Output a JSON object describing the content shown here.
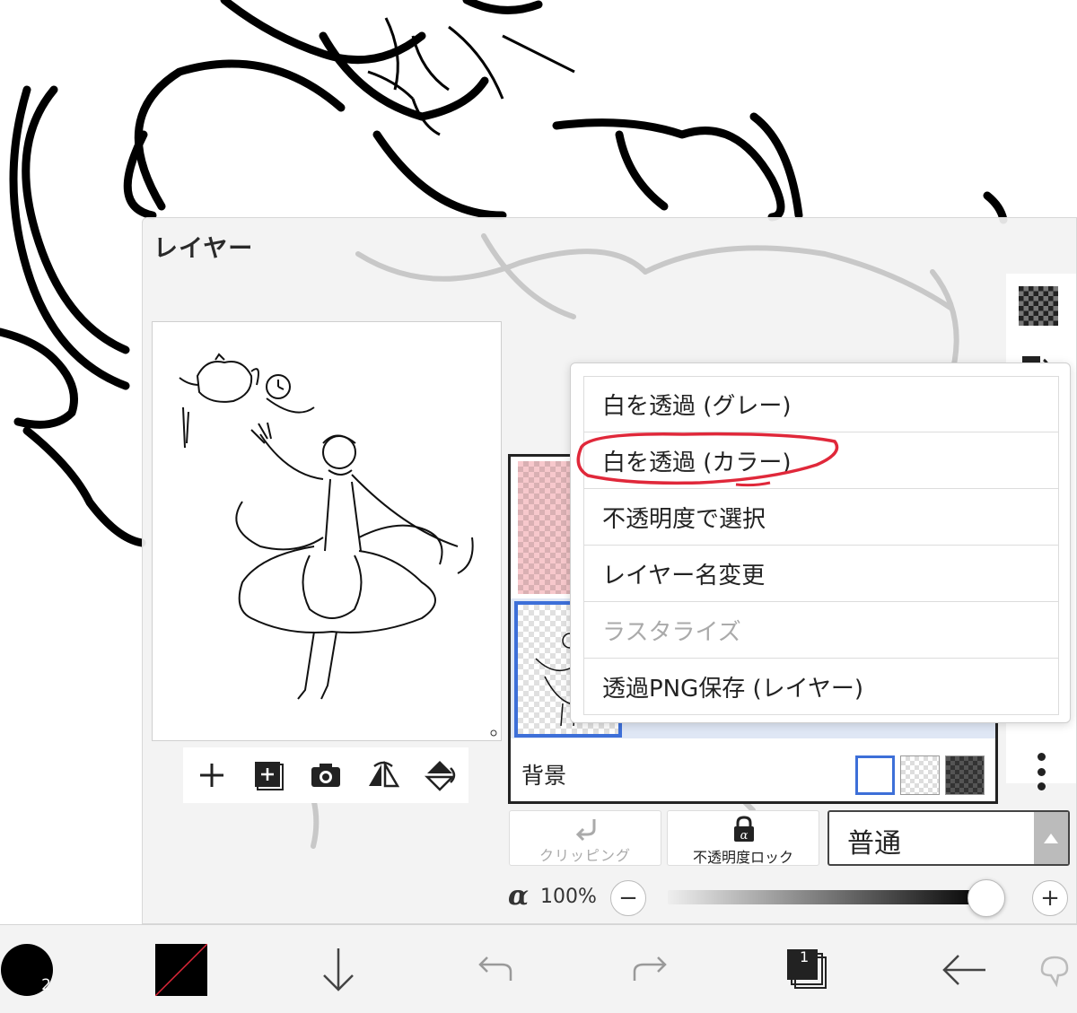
{
  "layer_panel": {
    "title": "レイヤー",
    "background_label": "背景"
  },
  "context_menu": {
    "items": [
      {
        "label": "白を透過 (グレー)",
        "enabled": true
      },
      {
        "label": "白を透過 (カラー)",
        "enabled": true,
        "annotated": true
      },
      {
        "label": "不透明度で選択",
        "enabled": true
      },
      {
        "label": "レイヤー名変更",
        "enabled": true
      },
      {
        "label": "ラスタライズ",
        "enabled": false
      },
      {
        "label": "透過PNG保存 (レイヤー)",
        "enabled": true
      }
    ],
    "annotation_color": "#e0283a"
  },
  "controls": {
    "clipping_label": "クリッピング",
    "alpha_lock_label": "不透明度ロック",
    "blend_mode": "普通",
    "alpha_symbol": "α",
    "opacity_text": "100%",
    "opacity": 1.0,
    "minus_label": "−",
    "plus_label": "+"
  },
  "toolbar": {
    "brush_size": "2",
    "layer_count": "1"
  },
  "colors": {
    "accent_blue": "#3d6fd8",
    "layer1_tint": "#f7c8cc"
  }
}
